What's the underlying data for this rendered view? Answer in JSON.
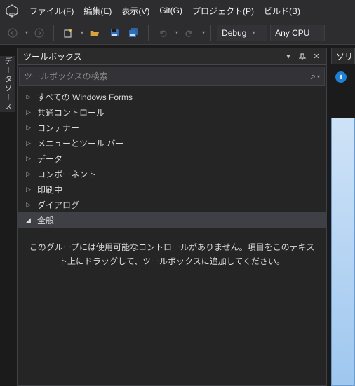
{
  "menubar": {
    "items": [
      {
        "label": "ファイル(F)"
      },
      {
        "label": "編集(E)"
      },
      {
        "label": "表示(V)"
      },
      {
        "label": "Git(G)"
      },
      {
        "label": "プロジェクト(P)"
      },
      {
        "label": "ビルド(B)"
      }
    ]
  },
  "toolbar": {
    "config_label": "Debug",
    "platform_label": "Any CPU"
  },
  "vtab_label": "データソース",
  "panel": {
    "title": "ツールボックス",
    "search_placeholder": "ツールボックスの検索",
    "groups": [
      {
        "label": "すべての Windows Forms",
        "expanded": false
      },
      {
        "label": "共通コントロール",
        "expanded": false
      },
      {
        "label": "コンテナー",
        "expanded": false
      },
      {
        "label": "メニューとツール バー",
        "expanded": false
      },
      {
        "label": "データ",
        "expanded": false
      },
      {
        "label": "コンポーネント",
        "expanded": false
      },
      {
        "label": "印刷中",
        "expanded": false
      },
      {
        "label": "ダイアログ",
        "expanded": false
      },
      {
        "label": "全般",
        "expanded": true,
        "selected": true
      }
    ],
    "empty_message": "このグループには使用可能なコントロールがありません。項目をこのテキスト上にドラッグして、ツールボックスに追加してください。"
  },
  "right": {
    "title_fragment": "ソリ"
  }
}
